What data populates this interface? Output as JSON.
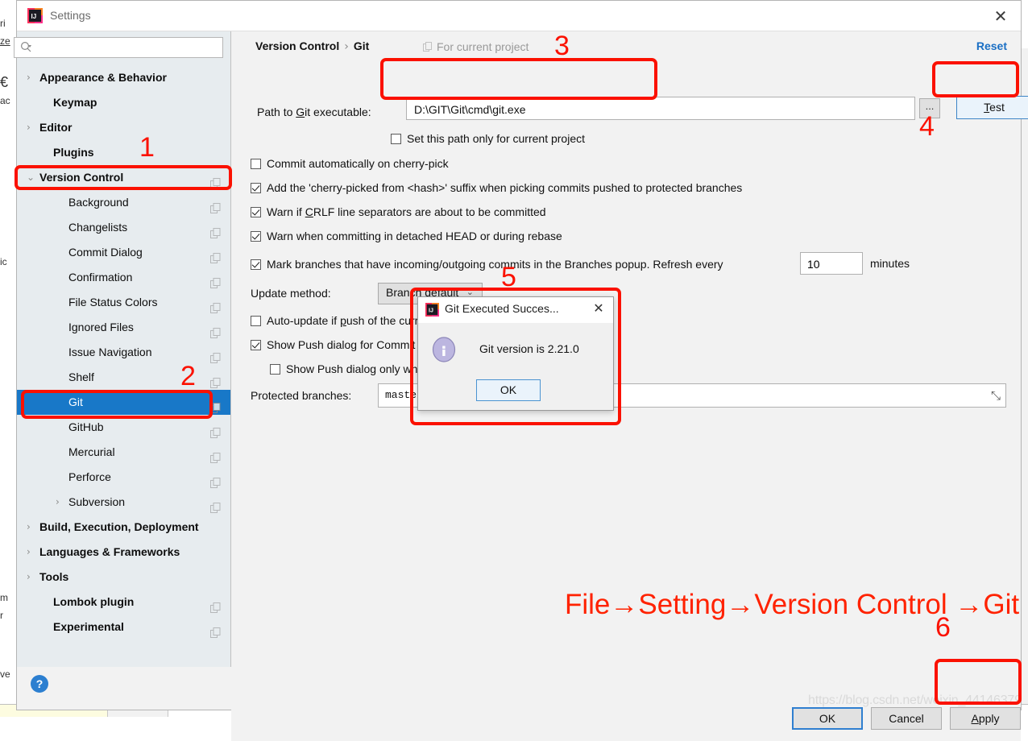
{
  "window": {
    "title": "Settings",
    "close_label": "✕",
    "logo_name": "intellij-idea-logo"
  },
  "search": {
    "value": "",
    "placeholder": ""
  },
  "sidebar": {
    "items": [
      {
        "label": "Appearance & Behavior",
        "arrow": "›",
        "indent": 28,
        "bold": true,
        "copy": false,
        "selected": false
      },
      {
        "label": "Keymap",
        "arrow": "",
        "indent": 45,
        "bold": true,
        "copy": false,
        "selected": false
      },
      {
        "label": "Editor",
        "arrow": "›",
        "indent": 28,
        "bold": true,
        "copy": false,
        "selected": false
      },
      {
        "label": "Plugins",
        "arrow": "",
        "indent": 45,
        "bold": true,
        "copy": false,
        "selected": false
      },
      {
        "label": "Version Control",
        "arrow": "⌄",
        "indent": 28,
        "bold": true,
        "copy": true,
        "selected": false
      },
      {
        "label": "Background",
        "arrow": "",
        "indent": 64,
        "bold": false,
        "copy": true,
        "selected": false
      },
      {
        "label": "Changelists",
        "arrow": "",
        "indent": 64,
        "bold": false,
        "copy": true,
        "selected": false
      },
      {
        "label": "Commit Dialog",
        "arrow": "",
        "indent": 64,
        "bold": false,
        "copy": true,
        "selected": false
      },
      {
        "label": "Confirmation",
        "arrow": "",
        "indent": 64,
        "bold": false,
        "copy": true,
        "selected": false
      },
      {
        "label": "File Status Colors",
        "arrow": "",
        "indent": 64,
        "bold": false,
        "copy": true,
        "selected": false
      },
      {
        "label": "Ignored Files",
        "arrow": "",
        "indent": 64,
        "bold": false,
        "copy": true,
        "selected": false
      },
      {
        "label": "Issue Navigation",
        "arrow": "",
        "indent": 64,
        "bold": false,
        "copy": true,
        "selected": false
      },
      {
        "label": "Shelf",
        "arrow": "",
        "indent": 64,
        "bold": false,
        "copy": true,
        "selected": false
      },
      {
        "label": "Git",
        "arrow": "",
        "indent": 64,
        "bold": false,
        "copy": true,
        "selected": true
      },
      {
        "label": "GitHub",
        "arrow": "",
        "indent": 64,
        "bold": false,
        "copy": true,
        "selected": false
      },
      {
        "label": "Mercurial",
        "arrow": "",
        "indent": 64,
        "bold": false,
        "copy": true,
        "selected": false
      },
      {
        "label": "Perforce",
        "arrow": "",
        "indent": 64,
        "bold": false,
        "copy": true,
        "selected": false
      },
      {
        "label": "Subversion",
        "arrow": "›",
        "indent": 64,
        "bold": false,
        "copy": true,
        "selected": false
      },
      {
        "label": "Build, Execution, Deployment",
        "arrow": "›",
        "indent": 28,
        "bold": true,
        "copy": false,
        "selected": false
      },
      {
        "label": "Languages & Frameworks",
        "arrow": "›",
        "indent": 28,
        "bold": true,
        "copy": false,
        "selected": false
      },
      {
        "label": "Tools",
        "arrow": "›",
        "indent": 28,
        "bold": true,
        "copy": false,
        "selected": false
      },
      {
        "label": "Lombok plugin",
        "arrow": "",
        "indent": 45,
        "bold": true,
        "copy": true,
        "selected": false
      },
      {
        "label": "Experimental",
        "arrow": "",
        "indent": 45,
        "bold": true,
        "copy": true,
        "selected": false
      }
    ],
    "help_label": "?"
  },
  "main": {
    "breadcrumb_root": "Version Control",
    "breadcrumb_sep": "›",
    "breadcrumb_leaf": "Git",
    "for_current_project": "For current project",
    "reset_label": "Reset",
    "path_label_pre": "Path to ",
    "path_label_underline": "G",
    "path_label_post": "it executable:",
    "path_value": "D:\\GIT\\Git\\cmd\\git.exe",
    "browse_label": "...",
    "test_underline": "T",
    "test_rest": "est",
    "checkboxes": [
      {
        "label": "Set this path only for current project",
        "checked": false
      },
      {
        "label": "Commit automatically on cherry-pick",
        "checked": false
      },
      {
        "label": "Add the 'cherry-picked from <hash>' suffix when picking commits pushed to protected branches",
        "checked": true
      },
      {
        "label_pre": "Warn if ",
        "underline": "C",
        "label_post": "RLF line separators are about to be committed",
        "checked": true
      },
      {
        "label": "Warn when committing in detached HEAD or during rebase",
        "checked": true
      },
      {
        "label": "Mark branches that have incoming/outgoing commits in the Branches popup.  Refresh every",
        "checked": true
      },
      {
        "label_pre": "Auto-update if ",
        "underline": "p",
        "label_post": "ush of the current branch was rejected",
        "checked": false
      },
      {
        "label": "Show Push dialog for Commit and Push",
        "checked": true
      },
      {
        "label": "Show Push dialog only when committing to protected branches",
        "checked": false
      }
    ],
    "refresh_value": "10",
    "minutes_label": "minutes",
    "update_method_label": "Update method:",
    "update_method_value": "Branch default",
    "update_method_chevron": "⌄",
    "protected_label": "Protected branches:",
    "protected_value": "master",
    "expand_icon": "⤡"
  },
  "footer": {
    "ok_label": "OK",
    "cancel_label": "Cancel",
    "apply_underline": "A",
    "apply_rest": "pply"
  },
  "dialog": {
    "title": "Git Executed Succes...",
    "close_label": "✕",
    "message": "Git version is 2.21.0",
    "ok_label": "OK"
  },
  "annotations": {
    "text": "File→Setting→Version Control →Git",
    "numbers": [
      "1",
      "2",
      "3",
      "4",
      "5",
      "6"
    ],
    "color": "#fb1100"
  },
  "watermark": "https://blog.csdn.net/weixin_44146379",
  "background_window": {
    "left_fragments": [
      "ri",
      "ze",
      "€",
      "ac",
      "ic",
      "m",
      "r",
      "ve"
    ],
    "right_fragment": "t"
  },
  "colors": {
    "accent_blue": "#1878c8",
    "link_blue": "#1a6fc4",
    "annotation_red": "#fb1100",
    "sidebar_bg": "#e7ecef",
    "panel_bg": "#f2f2f2"
  }
}
